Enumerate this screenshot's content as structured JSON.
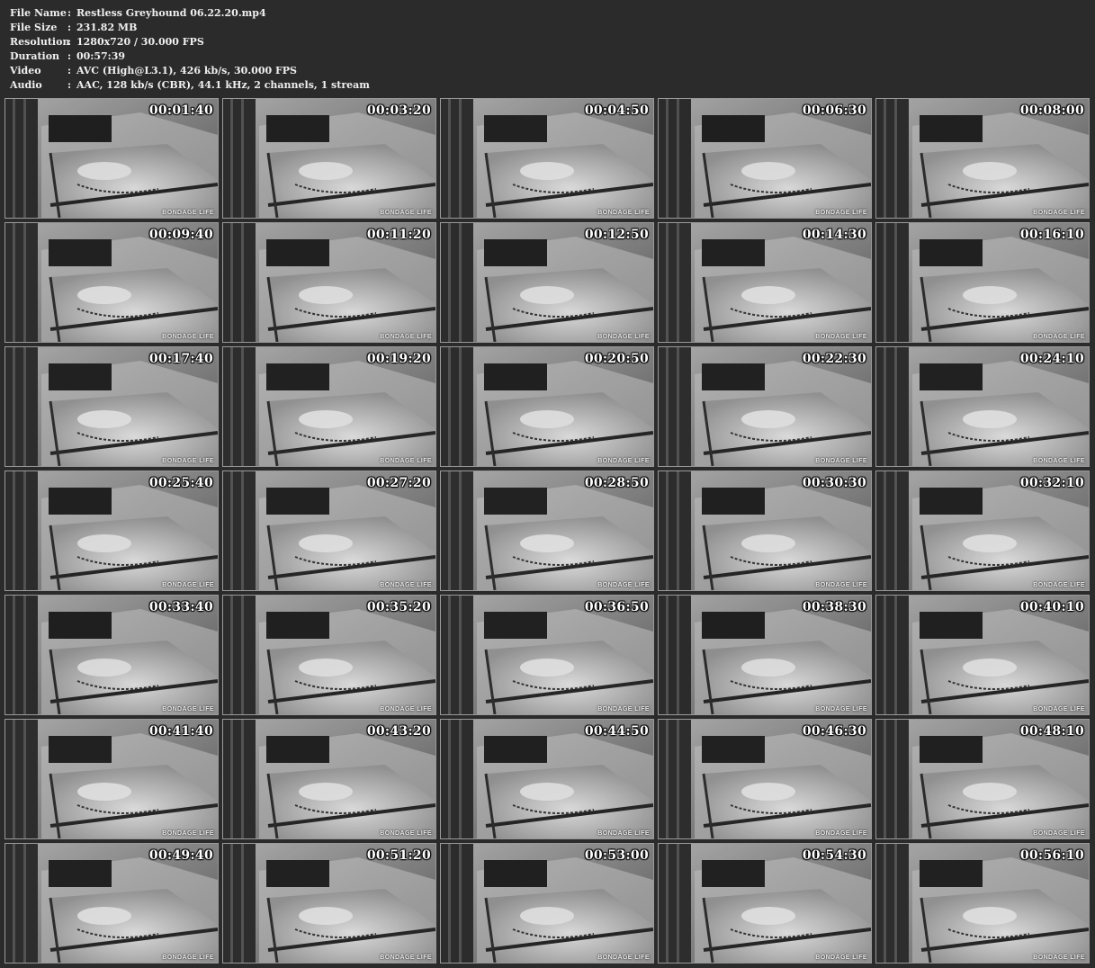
{
  "file_info": {
    "rows": [
      {
        "label": "File Name",
        "sep": ":",
        "value": "Restless Greyhound 06.22.20.mp4"
      },
      {
        "label": "File Size",
        "sep": ":",
        "value": "231.82 MB"
      },
      {
        "label": "Resolution",
        "sep": ":",
        "value": "1280x720 / 30.000 FPS"
      },
      {
        "label": "Duration",
        "sep": ":",
        "value": "00:57:39"
      },
      {
        "label": "Video",
        "sep": ":",
        "value": "AVC (High@L3.1), 426 kb/s, 30.000 FPS"
      },
      {
        "label": "Audio",
        "sep": ":",
        "value": "AAC, 128 kb/s (CBR), 44.1 kHz, 2 channels, 1 stream"
      }
    ]
  },
  "watermark": "BONDAGE LIFE",
  "thumbnails": [
    {
      "time": "00:01:40"
    },
    {
      "time": "00:03:20"
    },
    {
      "time": "00:04:50"
    },
    {
      "time": "00:06:30"
    },
    {
      "time": "00:08:00"
    },
    {
      "time": "00:09:40"
    },
    {
      "time": "00:11:20"
    },
    {
      "time": "00:12:50"
    },
    {
      "time": "00:14:30"
    },
    {
      "time": "00:16:10"
    },
    {
      "time": "00:17:40"
    },
    {
      "time": "00:19:20"
    },
    {
      "time": "00:20:50"
    },
    {
      "time": "00:22:30"
    },
    {
      "time": "00:24:10"
    },
    {
      "time": "00:25:40"
    },
    {
      "time": "00:27:20"
    },
    {
      "time": "00:28:50"
    },
    {
      "time": "00:30:30"
    },
    {
      "time": "00:32:10"
    },
    {
      "time": "00:33:40"
    },
    {
      "time": "00:35:20"
    },
    {
      "time": "00:36:50"
    },
    {
      "time": "00:38:30"
    },
    {
      "time": "00:40:10"
    },
    {
      "time": "00:41:40"
    },
    {
      "time": "00:43:20"
    },
    {
      "time": "00:44:50"
    },
    {
      "time": "00:46:30"
    },
    {
      "time": "00:48:10"
    },
    {
      "time": "00:49:40"
    },
    {
      "time": "00:51:20"
    },
    {
      "time": "00:53:00"
    },
    {
      "time": "00:54:30"
    },
    {
      "time": "00:56:10"
    }
  ]
}
